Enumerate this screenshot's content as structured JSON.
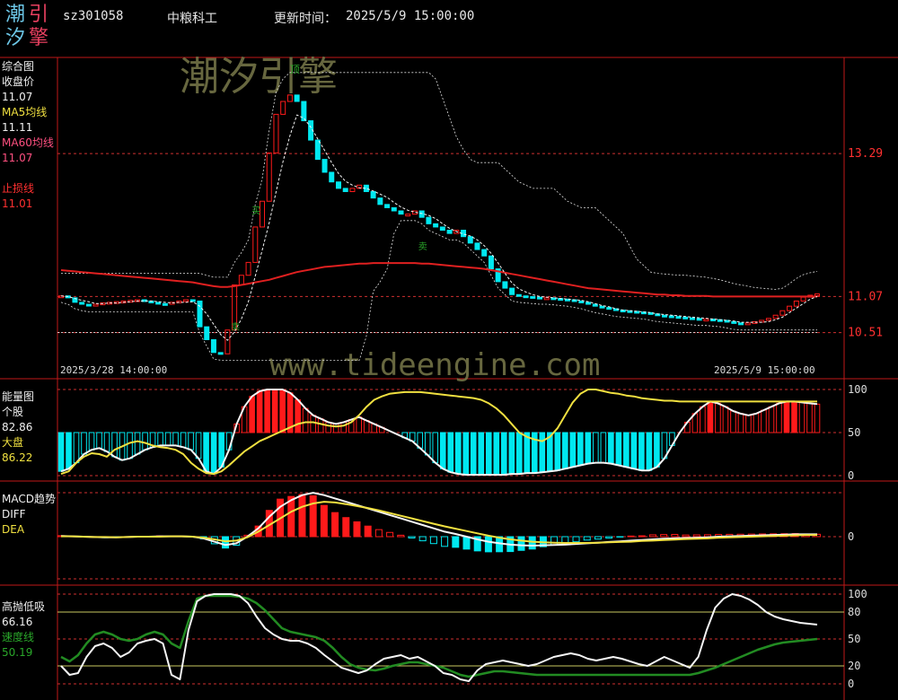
{
  "header": {
    "logo_chars": [
      "潮",
      "引",
      "汐",
      "擎"
    ],
    "code": "sz301058",
    "name": "中粮科工",
    "update_label": "更新时间：",
    "update_time": "2025/5/9 15:00:00"
  },
  "watermarks": {
    "cn": "潮汐引擎",
    "url": "www.tideengine.com"
  },
  "colors": {
    "background": "#000000",
    "frame": "#c01818",
    "up": "#ff1a1a",
    "down": "#00e8f0",
    "ma5": "#f5f5f5",
    "ma60": "#e02020",
    "dea": "#f0e040",
    "speed": "#228b22",
    "dash_white": "#e0e0e0",
    "dash_red": "#d03030",
    "label_white": "#f0f0f0",
    "label_yellow": "#f0e040",
    "label_pink": "#ff5080",
    "label_red": "#ff3030",
    "label_green": "#2aa82a",
    "axis_text": "#ff3030",
    "axis_text_white": "#dddddd"
  },
  "main_panel": {
    "labels": [
      {
        "text": "综合图",
        "color": "label_white"
      },
      {
        "text": "收盘价",
        "color": "label_white"
      },
      {
        "text": "11.07",
        "color": "label_white"
      },
      {
        "text": "MA5均线",
        "color": "label_yellow"
      },
      {
        "text": "11.11",
        "color": "label_white"
      },
      {
        "text": "MA60均线",
        "color": "label_pink"
      },
      {
        "text": "11.07",
        "color": "label_pink"
      },
      {
        "text": "",
        "color": "label_white"
      },
      {
        "text": "止损线",
        "color": "label_red"
      },
      {
        "text": "11.01",
        "color": "label_red"
      }
    ],
    "axis_ticks": [
      {
        "value": 13.29,
        "label": "13.29"
      },
      {
        "value": 11.07,
        "label": "11.07"
      },
      {
        "value": 10.51,
        "label": "10.51"
      }
    ],
    "start_date": "2025/3/28 14:00:00",
    "end_date": "2025/5/9 15:00:00",
    "marker_top": "顶",
    "marker_mid1": "买",
    "marker_mid2": "卖",
    "marker_mid3": "卖"
  },
  "energy_panel": {
    "labels": [
      {
        "text": "能量图",
        "color": "label_white"
      },
      {
        "text": "个股",
        "color": "label_white"
      },
      {
        "text": "82.86",
        "color": "label_white"
      },
      {
        "text": "大盘",
        "color": "label_yellow"
      },
      {
        "text": "86.22",
        "color": "label_yellow"
      }
    ],
    "axis_ticks": [
      {
        "value": 100,
        "label": "100"
      },
      {
        "value": 50,
        "label": "50"
      },
      {
        "value": 0,
        "label": "0"
      }
    ]
  },
  "macd_panel": {
    "labels": [
      {
        "text": "MACD趋势",
        "color": "label_white"
      },
      {
        "text": "DIFF",
        "color": "label_white"
      },
      {
        "text": "DEA",
        "color": "label_yellow"
      }
    ],
    "axis_ticks": [
      {
        "value": 0,
        "label": "0"
      }
    ]
  },
  "osc_panel": {
    "labels": [
      {
        "text": "高抛低吸",
        "color": "label_white"
      },
      {
        "text": "66.16",
        "color": "label_white"
      },
      {
        "text": "速度线",
        "color": "label_green"
      },
      {
        "text": "50.19",
        "color": "label_green"
      }
    ],
    "axis_ticks": [
      {
        "value": 100,
        "label": "100"
      },
      {
        "value": 80,
        "label": "80"
      },
      {
        "value": 50,
        "label": "50"
      },
      {
        "value": 20,
        "label": "20"
      },
      {
        "value": 0,
        "label": "0"
      }
    ]
  },
  "chart_data": {
    "type": "candlestick",
    "ylim": [
      10.1,
      14.7
    ],
    "close": [
      11.08,
      11.05,
      10.98,
      10.95,
      10.93,
      10.95,
      10.97,
      10.98,
      10.99,
      11.0,
      11.01,
      11.02,
      11.0,
      10.98,
      10.96,
      10.95,
      10.98,
      11.0,
      11.02,
      11.0,
      10.6,
      10.4,
      10.2,
      10.18,
      10.55,
      11.25,
      11.4,
      11.6,
      12.15,
      12.55,
      13.3,
      13.9,
      14.1,
      14.2,
      14.1,
      13.8,
      13.5,
      13.2,
      13.0,
      12.85,
      12.75,
      12.7,
      12.75,
      12.8,
      12.7,
      12.6,
      12.5,
      12.45,
      12.4,
      12.35,
      12.35,
      12.4,
      12.3,
      12.2,
      12.15,
      12.1,
      12.05,
      12.1,
      12.0,
      11.9,
      11.8,
      11.7,
      11.5,
      11.3,
      11.2,
      11.1,
      11.08,
      11.07,
      11.06,
      11.05,
      11.05,
      11.04,
      11.03,
      11.02,
      11.0,
      10.98,
      10.95,
      10.92,
      10.9,
      10.88,
      10.86,
      10.85,
      10.84,
      10.83,
      10.82,
      10.8,
      10.78,
      10.77,
      10.76,
      10.75,
      10.74,
      10.73,
      10.72,
      10.72,
      10.71,
      10.7,
      10.68,
      10.66,
      10.65,
      10.66,
      10.68,
      10.7,
      10.73,
      10.78,
      10.85,
      10.92,
      11.0,
      11.06,
      11.09,
      11.11
    ],
    "ma5": [
      11.08,
      11.07,
      11.04,
      11.01,
      10.99,
      10.96,
      10.96,
      10.97,
      10.97,
      10.98,
      10.99,
      11.0,
      11.0,
      11.0,
      10.99,
      10.98,
      10.97,
      10.98,
      10.98,
      10.99,
      10.92,
      10.8,
      10.64,
      10.48,
      10.39,
      10.52,
      10.72,
      10.99,
      11.39,
      11.79,
      12.21,
      12.7,
      13.17,
      13.57,
      13.89,
      13.84,
      13.7,
      13.52,
      13.34,
      13.15,
      12.98,
      12.86,
      12.8,
      12.76,
      12.75,
      12.71,
      12.66,
      12.61,
      12.53,
      12.46,
      12.41,
      12.38,
      12.36,
      12.33,
      12.28,
      12.2,
      12.13,
      12.08,
      12.04,
      12.01,
      11.95,
      11.86,
      11.74,
      11.59,
      11.43,
      11.28,
      11.19,
      11.14,
      11.1,
      11.07,
      11.06,
      11.05,
      11.04,
      11.03,
      11.02,
      11.01,
      10.99,
      10.96,
      10.93,
      10.91,
      10.88,
      10.86,
      10.85,
      10.84,
      10.83,
      10.82,
      10.8,
      10.79,
      10.78,
      10.77,
      10.76,
      10.75,
      10.74,
      10.73,
      10.72,
      10.71,
      10.7,
      10.69,
      10.67,
      10.67,
      10.67,
      10.67,
      10.68,
      10.71,
      10.75,
      10.82,
      10.89,
      10.96,
      11.03,
      11.07
    ],
    "ma60": [
      11.48,
      11.47,
      11.46,
      11.45,
      11.44,
      11.43,
      11.42,
      11.41,
      11.4,
      11.39,
      11.38,
      11.37,
      11.36,
      11.35,
      11.34,
      11.33,
      11.32,
      11.31,
      11.3,
      11.29,
      11.27,
      11.25,
      11.23,
      11.22,
      11.22,
      11.23,
      11.25,
      11.27,
      11.29,
      11.31,
      11.33,
      11.36,
      11.39,
      11.42,
      11.45,
      11.47,
      11.49,
      11.51,
      11.53,
      11.54,
      11.55,
      11.56,
      11.57,
      11.58,
      11.58,
      11.59,
      11.59,
      11.59,
      11.59,
      11.59,
      11.59,
      11.59,
      11.58,
      11.58,
      11.57,
      11.56,
      11.55,
      11.54,
      11.53,
      11.52,
      11.51,
      11.5,
      11.48,
      11.46,
      11.44,
      11.42,
      11.4,
      11.38,
      11.36,
      11.34,
      11.32,
      11.3,
      11.28,
      11.26,
      11.24,
      11.22,
      11.2,
      11.19,
      11.18,
      11.17,
      11.16,
      11.15,
      11.14,
      11.13,
      11.12,
      11.11,
      11.1,
      11.1,
      11.09,
      11.09,
      11.08,
      11.08,
      11.08,
      11.08,
      11.07,
      11.07,
      11.07,
      11.07,
      11.07,
      11.07,
      11.07,
      11.07,
      11.07,
      11.07,
      11.07,
      11.07,
      11.07,
      11.07,
      11.07,
      11.07
    ],
    "stop_line": 10.51,
    "energy_stock": [
      5,
      8,
      15,
      25,
      30,
      32,
      28,
      22,
      18,
      20,
      25,
      30,
      33,
      35,
      35,
      35,
      33,
      30,
      20,
      5,
      2,
      10,
      30,
      60,
      80,
      92,
      98,
      100,
      100,
      100,
      96,
      88,
      78,
      70,
      66,
      62,
      60,
      62,
      65,
      68,
      64,
      60,
      56,
      52,
      48,
      44,
      40,
      32,
      24,
      15,
      8,
      4,
      2,
      1,
      1,
      1,
      1,
      1,
      1,
      2,
      2,
      3,
      3,
      4,
      5,
      6,
      8,
      10,
      12,
      14,
      15,
      15,
      14,
      12,
      10,
      8,
      6,
      6,
      10,
      20,
      35,
      50,
      62,
      72,
      80,
      86,
      84,
      80,
      75,
      72,
      70,
      72,
      76,
      80,
      84,
      86,
      86,
      85,
      84,
      83
    ],
    "energy_market": [
      2,
      5,
      15,
      22,
      26,
      25,
      22,
      30,
      34,
      38,
      40,
      38,
      35,
      33,
      32,
      30,
      25,
      15,
      8,
      3,
      2,
      5,
      12,
      20,
      28,
      34,
      40,
      44,
      48,
      52,
      56,
      60,
      62,
      62,
      60,
      58,
      57,
      58,
      62,
      70,
      80,
      88,
      92,
      95,
      96,
      97,
      97,
      97,
      96,
      95,
      94,
      93,
      92,
      91,
      90,
      88,
      84,
      78,
      70,
      60,
      50,
      45,
      42,
      40,
      45,
      55,
      70,
      85,
      95,
      100,
      100,
      98,
      96,
      95,
      93,
      92,
      90,
      89,
      88,
      87,
      87,
      86,
      86,
      86,
      86,
      86,
      86,
      86,
      86,
      86,
      86,
      86,
      86,
      86,
      86,
      86,
      86,
      86,
      86,
      86
    ],
    "macd_diff": [
      0.02,
      0.01,
      0.0,
      -0.01,
      -0.02,
      -0.02,
      -0.01,
      0.0,
      0.0,
      0.01,
      0.01,
      0.01,
      0.0,
      -0.05,
      -0.15,
      -0.25,
      -0.2,
      0.0,
      0.25,
      0.6,
      0.9,
      1.1,
      1.25,
      1.32,
      1.25,
      1.15,
      1.05,
      0.95,
      0.85,
      0.75,
      0.65,
      0.55,
      0.45,
      0.35,
      0.25,
      0.15,
      0.08,
      0.0,
      -0.08,
      -0.15,
      -0.2,
      -0.24,
      -0.26,
      -0.27,
      -0.26,
      -0.25,
      -0.24,
      -0.22,
      -0.2,
      -0.18,
      -0.16,
      -0.14,
      -0.12,
      -0.1,
      -0.08,
      -0.06,
      -0.05,
      -0.04,
      -0.03,
      -0.02,
      0.0,
      0.01,
      0.02,
      0.03,
      0.04,
      0.05,
      0.06,
      0.07,
      0.07,
      0.07
    ],
    "macd_dea": [
      0.01,
      0.01,
      0.0,
      -0.01,
      -0.01,
      -0.02,
      -0.01,
      0.0,
      0.0,
      0.0,
      0.01,
      0.01,
      0.0,
      -0.03,
      -0.08,
      -0.14,
      -0.12,
      -0.02,
      0.15,
      0.35,
      0.55,
      0.75,
      0.9,
      1.0,
      1.05,
      1.03,
      0.98,
      0.92,
      0.86,
      0.79,
      0.71,
      0.63,
      0.55,
      0.47,
      0.39,
      0.31,
      0.24,
      0.17,
      0.1,
      0.03,
      -0.03,
      -0.08,
      -0.12,
      -0.15,
      -0.17,
      -0.18,
      -0.19,
      -0.19,
      -0.19,
      -0.18,
      -0.17,
      -0.16,
      -0.15,
      -0.13,
      -0.12,
      -0.1,
      -0.09,
      -0.07,
      -0.06,
      -0.05,
      -0.03,
      -0.02,
      -0.01,
      0.0,
      0.01,
      0.02,
      0.03,
      0.04,
      0.05,
      0.05
    ],
    "osc_white": [
      20,
      10,
      12,
      30,
      42,
      45,
      40,
      30,
      35,
      45,
      48,
      50,
      45,
      10,
      5,
      60,
      92,
      98,
      100,
      100,
      100,
      98,
      90,
      75,
      62,
      55,
      50,
      48,
      48,
      45,
      40,
      32,
      25,
      18,
      15,
      12,
      15,
      22,
      28,
      30,
      32,
      28,
      30,
      25,
      20,
      12,
      10,
      5,
      3,
      15,
      22,
      24,
      26,
      24,
      22,
      20,
      22,
      26,
      30,
      32,
      34,
      32,
      28,
      26,
      28,
      30,
      28,
      25,
      22,
      20,
      25,
      30,
      26,
      22,
      18,
      30,
      60,
      85,
      95,
      100,
      98,
      94,
      88,
      80,
      75,
      72,
      70,
      68,
      67,
      66
    ],
    "osc_speed": [
      30,
      25,
      32,
      45,
      55,
      58,
      55,
      50,
      48,
      50,
      55,
      58,
      55,
      45,
      40,
      70,
      95,
      98,
      98,
      98,
      98,
      97,
      95,
      90,
      82,
      72,
      62,
      58,
      56,
      54,
      52,
      48,
      40,
      30,
      22,
      18,
      16,
      15,
      17,
      20,
      22,
      24,
      24,
      22,
      20,
      18,
      14,
      10,
      8,
      10,
      12,
      14,
      14,
      13,
      12,
      11,
      10,
      10,
      10,
      10,
      10,
      10,
      10,
      10,
      10,
      10,
      10,
      10,
      10,
      10,
      10,
      10,
      10,
      10,
      10,
      12,
      15,
      18,
      22,
      26,
      30,
      34,
      38,
      41,
      44,
      46,
      47,
      48,
      49,
      50
    ]
  }
}
